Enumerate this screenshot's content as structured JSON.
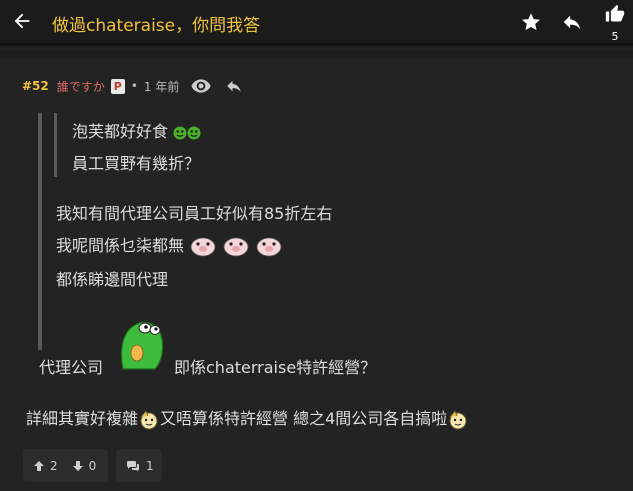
{
  "header": {
    "title": "做過chateraise，你問我答",
    "like_count": "5",
    "icons": [
      "back-arrow-icon",
      "star-icon",
      "reply-icon",
      "thumbs-up-icon"
    ]
  },
  "post": {
    "floor": "#52",
    "author": "誰ですか",
    "badge": "P",
    "separator": "•",
    "time": "1 年前",
    "quote_inner": {
      "line1": "泡芙都好好食",
      "line2": "員工買野有幾折？"
    },
    "quote_outer": {
      "line1": "我知有間代理公司員工好似有85折左右",
      "line2": "我呢間係乜柒都無",
      "line3": "都係睇邊間代理",
      "line4a": "代理公司",
      "line4b": "即係chaterraise特許經營？"
    },
    "reply": {
      "part1": "詳細其實好複雜",
      "part2": "又唔算係特許經營 總之4間公司各自搞啦"
    },
    "footer": {
      "upvotes": "2",
      "downvotes": "0",
      "replies": "1"
    }
  },
  "colors": {
    "accent": "#f0c33d",
    "author": "#e06a64",
    "background": "#232323"
  }
}
